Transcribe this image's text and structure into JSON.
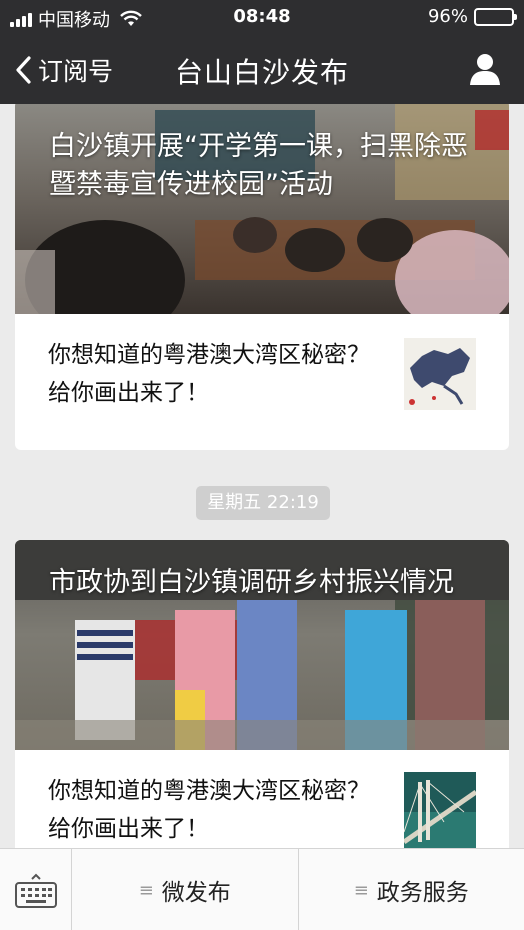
{
  "status": {
    "carrier": "中国移动",
    "time": "08:48",
    "battery": "96%",
    "battery_level": 0.96
  },
  "nav": {
    "back_label": "订阅号",
    "title": "台山白沙发布"
  },
  "feed": {
    "cards": [
      {
        "cover_title": "白沙镇开展“开学第一课，扫黑除恶暨禁毒宣传进校园”活动",
        "item_title": "你想知道的粤港澳大湾区秘密？给你画出来了！"
      },
      {
        "cover_title": "市政协到白沙镇调研乡村振兴情况",
        "item_title": "你想知道的粤港澳大湾区秘密？给你画出来了！"
      }
    ],
    "timestamp": "星期五 22:19"
  },
  "menu": {
    "items": [
      {
        "label": "微发布"
      },
      {
        "label": "政务服务"
      }
    ]
  },
  "icons": [
    "signal-icon",
    "wifi-icon",
    "battery-icon",
    "back-chevron-icon",
    "user-icon",
    "keyboard-icon",
    "menu-list-icon"
  ]
}
